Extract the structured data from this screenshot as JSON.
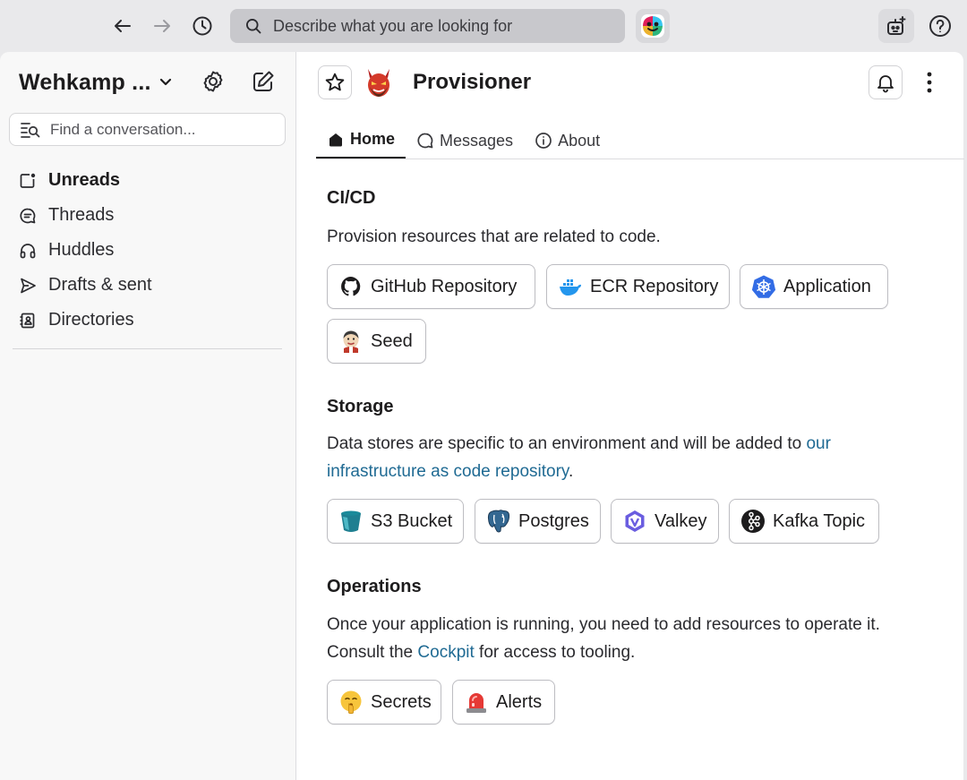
{
  "topbar": {
    "search_placeholder": "Describe what you are looking for"
  },
  "sidebar": {
    "workspace_name": "Wehkamp ...",
    "find_placeholder": "Find a conversation...",
    "items": [
      {
        "label": "Unreads",
        "icon": "unreads-icon"
      },
      {
        "label": "Threads",
        "icon": "threads-icon"
      },
      {
        "label": "Huddles",
        "icon": "headphones-icon"
      },
      {
        "label": "Drafts & sent",
        "icon": "send-icon"
      },
      {
        "label": "Directories",
        "icon": "directory-icon"
      }
    ]
  },
  "channel": {
    "title": "Provisioner",
    "tabs": [
      {
        "label": "Home",
        "icon": "home-icon",
        "active": true
      },
      {
        "label": "Messages",
        "icon": "message-icon"
      },
      {
        "label": "About",
        "icon": "info-icon"
      }
    ]
  },
  "sections": {
    "cicd": {
      "title": "CI/CD",
      "text": "Provision resources that are related to code.",
      "buttons": [
        {
          "label": "GitHub Repository",
          "icon": "github-icon"
        },
        {
          "label": "ECR Repository",
          "icon": "docker-icon"
        },
        {
          "label": "Application",
          "icon": "kubernetes-icon"
        },
        {
          "label": "Seed",
          "icon": "jenkins-icon"
        }
      ]
    },
    "storage": {
      "title": "Storage",
      "text_before": "Data stores are specific to an environment and will be added to ",
      "link_1": "our",
      "link_2": "infrastructure as code repository",
      "text_after": ".",
      "buttons": [
        {
          "label": "S3 Bucket",
          "icon": "bucket-icon"
        },
        {
          "label": "Postgres",
          "icon": "postgres-icon"
        },
        {
          "label": "Valkey",
          "icon": "valkey-icon"
        },
        {
          "label": "Kafka Topic",
          "icon": "kafka-icon"
        }
      ]
    },
    "operations": {
      "title": "Operations",
      "text_before": "Once your application is running, you need to add resources to operate it. Consult the ",
      "link": "Cockpit",
      "text_after": " for access to tooling.",
      "buttons": [
        {
          "label": "Secrets",
          "icon": "shushing-face-icon"
        },
        {
          "label": "Alerts",
          "icon": "siren-icon"
        }
      ]
    }
  },
  "colors": {
    "link": "#1f6a93",
    "chrome": "#e9e9eb",
    "sidebar": "#f8f8f8"
  }
}
